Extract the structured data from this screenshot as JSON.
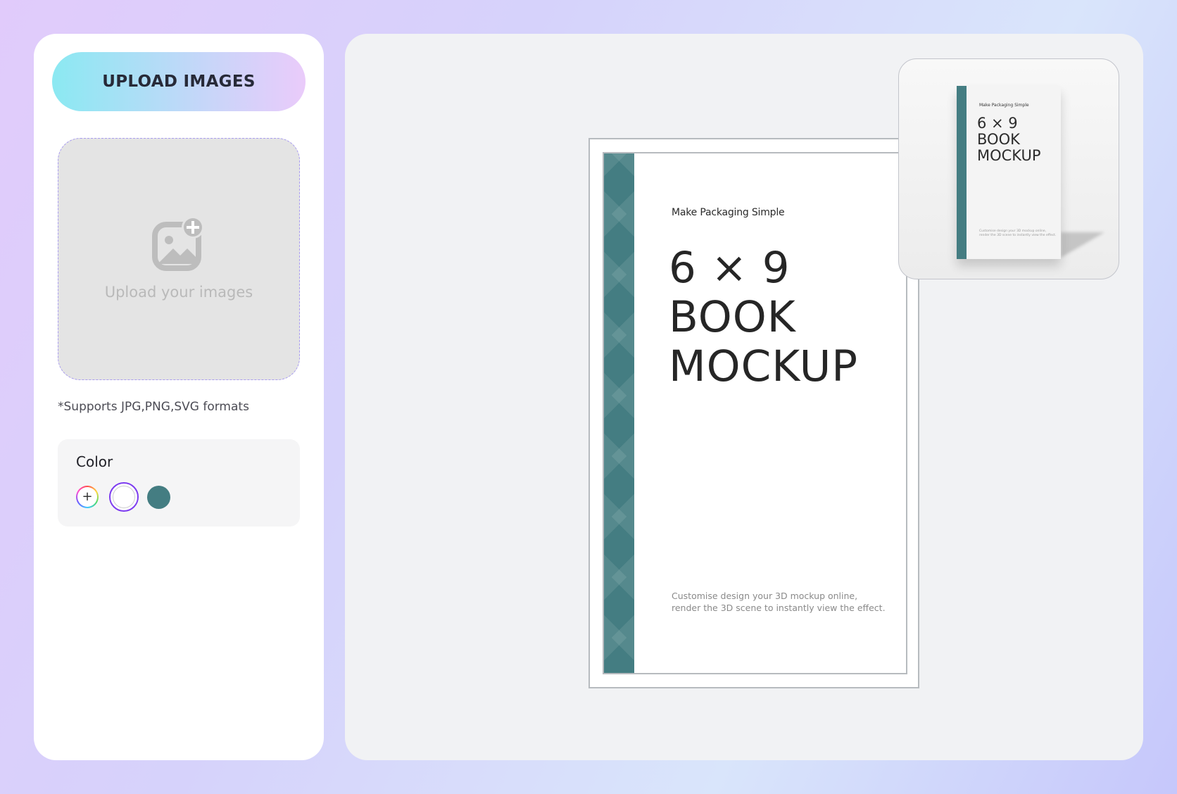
{
  "sidebar": {
    "upload_button_label": "UPLOAD IMAGES",
    "dropzone_label": "Upload your images",
    "formats_note": "*Supports JPG,PNG,SVG formats",
    "color_section": {
      "title": "Color",
      "swatches": [
        {
          "name": "custom-color",
          "symbol": "+"
        },
        {
          "name": "white",
          "hex": "#ffffff",
          "selected": true
        },
        {
          "name": "teal",
          "hex": "#447d82"
        }
      ]
    }
  },
  "book": {
    "tagline": "Make Packaging Simple",
    "title_line1": "6 × 9",
    "title_line2": "BOOK",
    "title_line3": "MOCKUP",
    "description_line1": "Customise design your 3D mockup online,",
    "description_line2": "render the 3D scene to instantly view the effect.",
    "spine_color": "#447d82"
  },
  "preview": {
    "tagline": "Make Packaging Simple",
    "title_line1": "6 × 9",
    "title_line2": "BOOK",
    "title_line3": "MOCKUP",
    "description_line1": "Customise design your 3D mockup online,",
    "description_line2": "render the 3D scene to instantly view the effect."
  },
  "colors": {
    "accent": "#7d3cf0",
    "dropzone_border": "#a99cf0",
    "upload_gradient_start": "#8be9f2",
    "upload_gradient_end": "#eacbfa"
  },
  "icons": {
    "dropzone_icon": "image-add-icon"
  }
}
